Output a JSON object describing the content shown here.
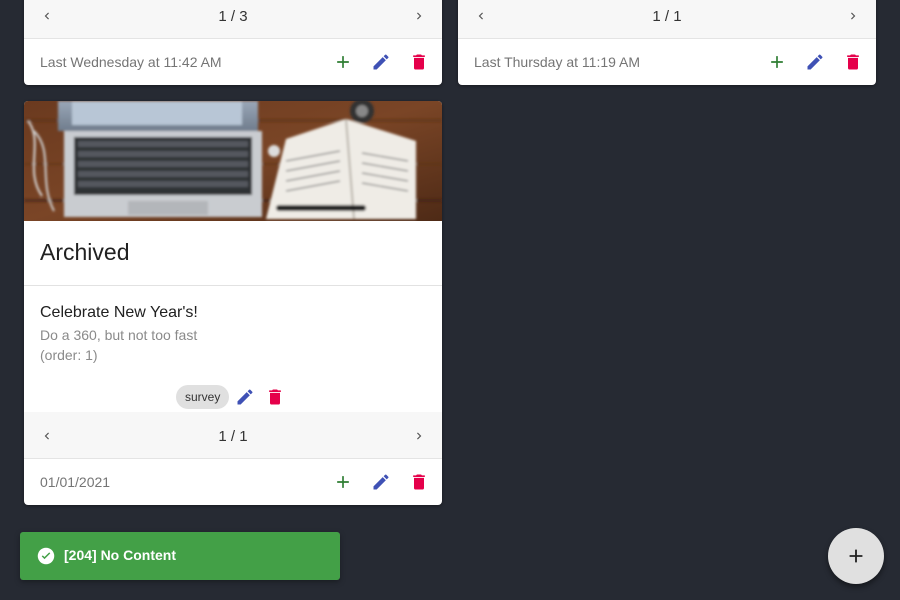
{
  "cards": [
    {
      "pager": {
        "count": "1 / 3"
      },
      "footer": {
        "timestamp": "Last Wednesday at 11:42 AM"
      }
    },
    {
      "pager": {
        "count": "1 / 1"
      },
      "footer": {
        "timestamp": "Last Thursday at 11:19 AM"
      }
    },
    {
      "title": "Archived",
      "item": {
        "title": "Celebrate New Year's!",
        "description": "Do a 360, but not too fast",
        "order": "(order: 1)",
        "tag": "survey"
      },
      "pager": {
        "count": "1 / 1"
      },
      "footer": {
        "timestamp": "01/01/2021"
      }
    }
  ],
  "toast": {
    "message": "[204] No Content",
    "icon": "check-circle-icon",
    "color": "#43a047"
  },
  "fab": {
    "icon": "plus-icon"
  },
  "colors": {
    "background": "#262a33",
    "add": "#2e7d32",
    "edit": "#3f51b5",
    "delete": "#e5004a"
  }
}
